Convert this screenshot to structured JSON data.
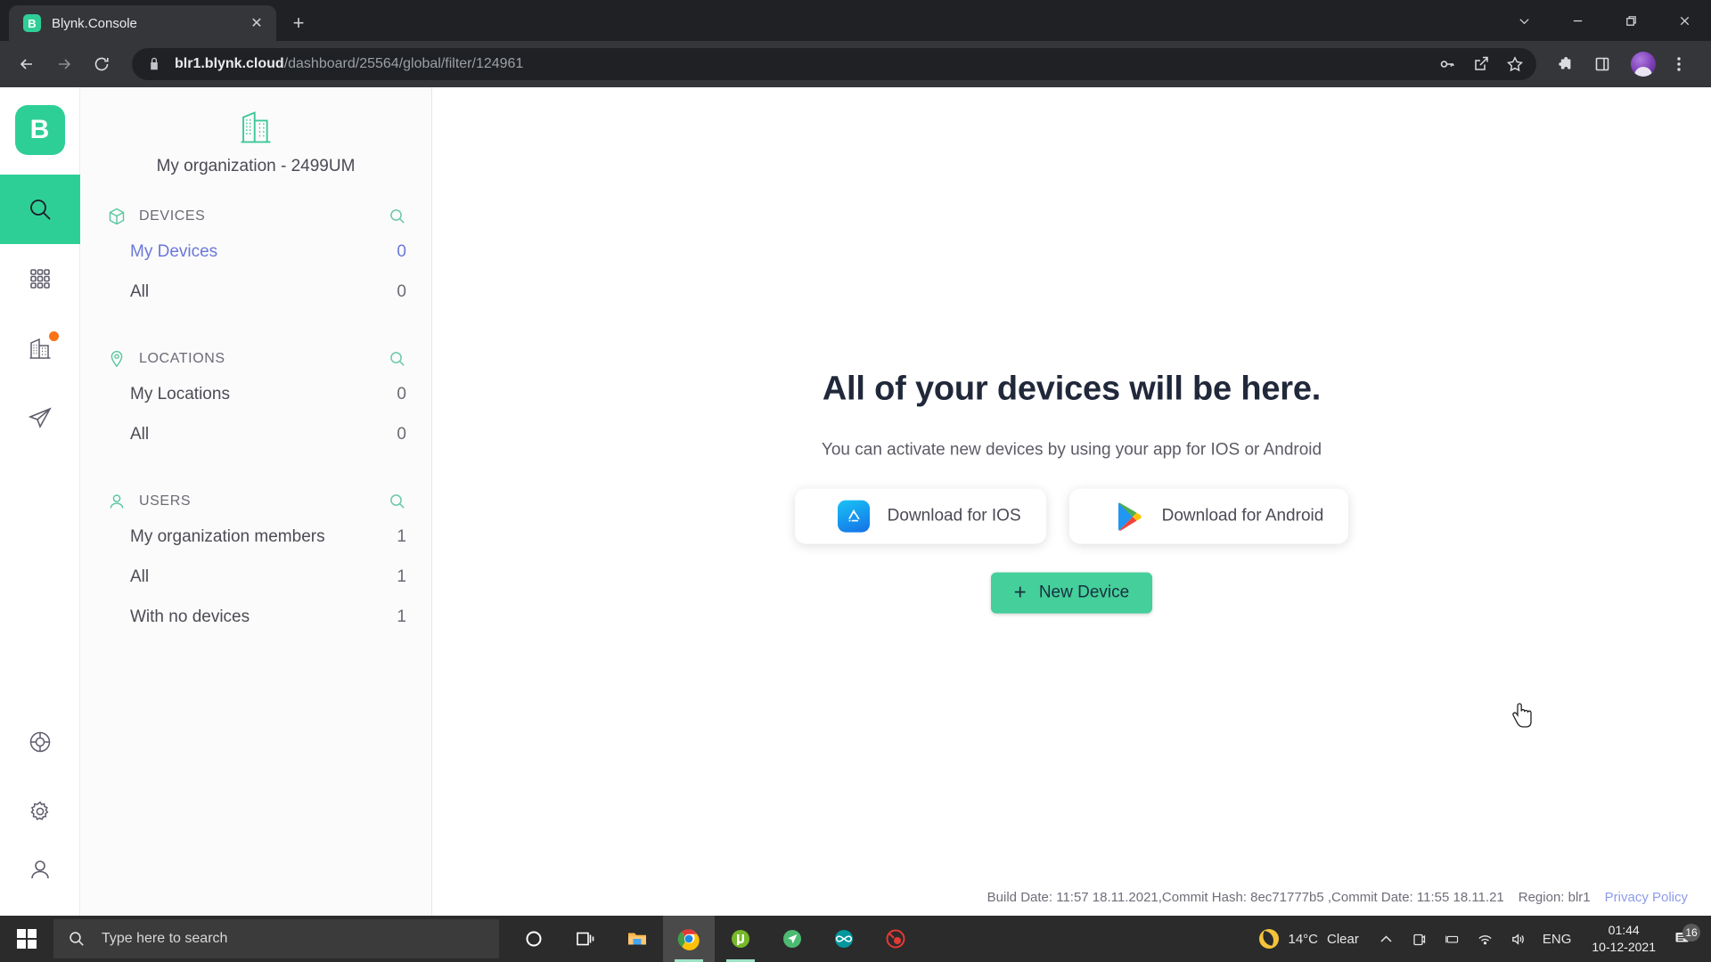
{
  "browser": {
    "tab": {
      "title": "Blynk.Console",
      "favicon_letter": "B",
      "close_label": "✕"
    },
    "new_tab_label": "+",
    "window_controls": {
      "minimize": "minimize-icon",
      "maximize": "maximize-icon",
      "close": "close-icon",
      "more": "chevron-down-icon"
    },
    "url": {
      "domain": "blr1.blynk.cloud",
      "path": "/dashboard/25564/global/filter/124961"
    },
    "toolbar_icons": [
      "back-icon",
      "forward-icon",
      "reload-icon",
      "password-key-icon",
      "share-icon",
      "bookmark-star-icon",
      "extensions-puzzle-icon",
      "side-panel-icon",
      "profile-avatar",
      "chrome-menu-icon"
    ]
  },
  "rail": {
    "logo_letter": "B",
    "items": [
      {
        "name": "search",
        "icon": "search-icon",
        "active": true,
        "badge": false
      },
      {
        "name": "apps",
        "icon": "grid-apps-icon",
        "active": false,
        "badge": false
      },
      {
        "name": "organizations",
        "icon": "organization-building-icon",
        "active": false,
        "badge": true
      },
      {
        "name": "send",
        "icon": "paper-plane-icon",
        "active": false,
        "badge": false
      }
    ],
    "bottom_items": [
      {
        "name": "help",
        "icon": "lifebuoy-icon"
      },
      {
        "name": "settings",
        "icon": "gear-icon"
      },
      {
        "name": "account",
        "icon": "user-icon"
      }
    ]
  },
  "sidebar": {
    "organization": {
      "name": "My organization - 2499UM",
      "icon": "organization-building-icon"
    },
    "groups": [
      {
        "label": "DEVICES",
        "icon": "cube-icon",
        "search_icon": "search-icon",
        "rows": [
          {
            "label": "My Devices",
            "count": "0",
            "active": true
          },
          {
            "label": "All",
            "count": "0",
            "active": false
          }
        ]
      },
      {
        "label": "LOCATIONS",
        "icon": "location-pin-icon",
        "search_icon": "search-icon",
        "rows": [
          {
            "label": "My Locations",
            "count": "0",
            "active": false
          },
          {
            "label": "All",
            "count": "0",
            "active": false
          }
        ]
      },
      {
        "label": "USERS",
        "icon": "user-icon",
        "search_icon": "search-icon",
        "rows": [
          {
            "label": "My organization members",
            "count": "1",
            "active": false
          },
          {
            "label": "All",
            "count": "1",
            "active": false
          },
          {
            "label": "With no devices",
            "count": "1",
            "active": false
          }
        ]
      }
    ]
  },
  "main": {
    "heading": "All of your devices will be here.",
    "subtitle": "You can activate new devices by using your app for IOS or Android",
    "ios_button": "Download for IOS",
    "android_button": "Download for Android",
    "new_device_button": "New Device",
    "new_device_plus": "+"
  },
  "footer": {
    "build_info": "Build Date: 11:57 18.11.2021,Commit Hash: 8ec71777b5 ,Commit Date: 11:55 18.11.21",
    "region": "Region: blr1",
    "privacy_link": "Privacy Policy"
  },
  "taskbar": {
    "search_placeholder": "Type here to search",
    "apps": [
      "cortana-icon",
      "task-view-icon",
      "file-explorer-icon",
      "chrome-icon",
      "utorrent-icon",
      "navigation-app-icon",
      "arduino-icon",
      "red-app-icon"
    ],
    "weather": {
      "temperature": "14°C",
      "condition": "Clear",
      "icon": "moon-icon"
    },
    "tray_icons": [
      "chevron-up-icon",
      "onedrive-icon",
      "battery-icon",
      "wifi-icon",
      "volume-icon"
    ],
    "language": "ENG",
    "time": "01:44",
    "date": "10-12-2021",
    "notification_count": "16"
  },
  "colors": {
    "brand_green": "#2ecf96",
    "button_green": "#45cf9a",
    "active_blue": "#6b78d8",
    "badge_orange": "#f97316"
  }
}
